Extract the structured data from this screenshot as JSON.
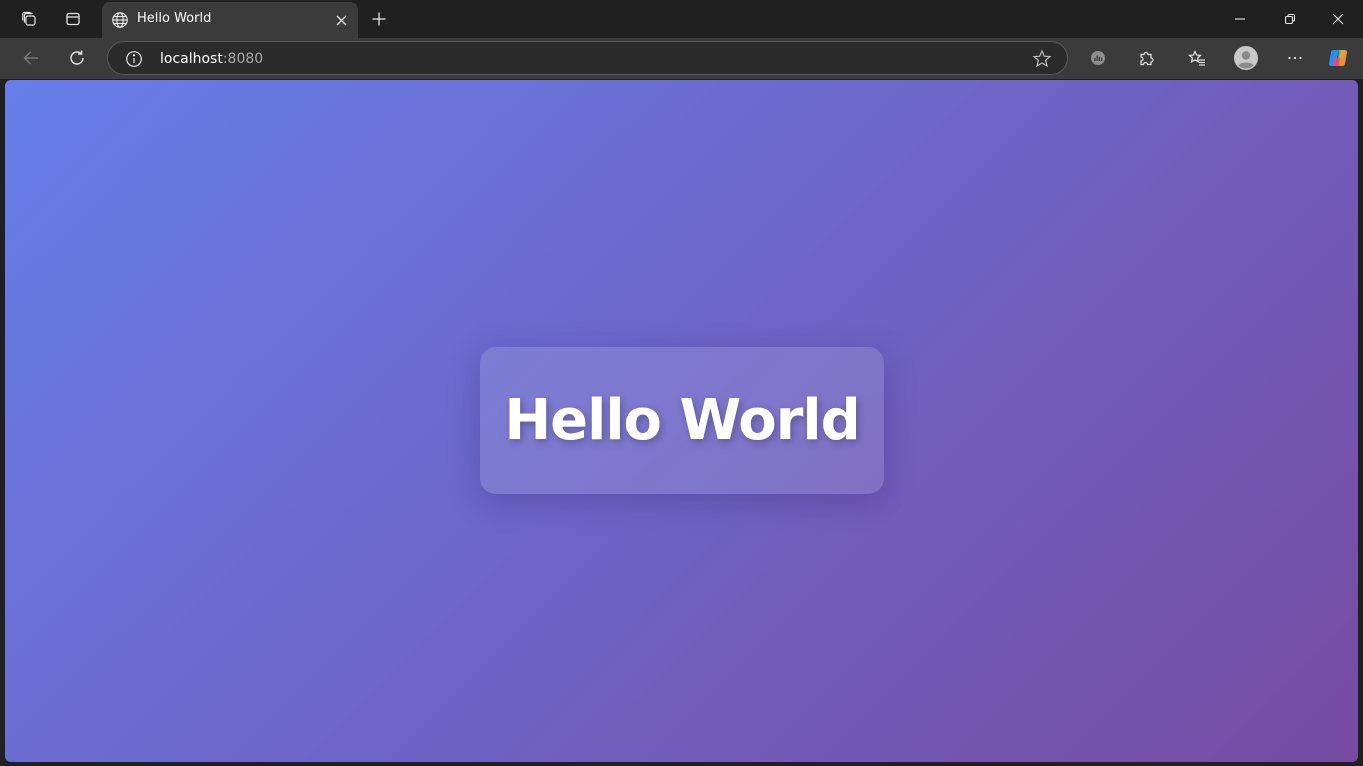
{
  "browser": {
    "tab": {
      "title": "Hello World",
      "favicon": "globe-icon"
    },
    "titlebar_icons": [
      "workspaces-icon",
      "tab-actions-icon",
      "new-tab-icon"
    ],
    "window_controls": [
      "minimize-icon",
      "restore-icon",
      "close-icon"
    ],
    "address_bar": {
      "host": "localhost",
      "port": ":8080",
      "site_info_icon": "info-icon",
      "favorite_icon": "star-icon"
    },
    "toolbar_icons": [
      "back-icon",
      "refresh-icon",
      "performance-icon",
      "extensions-icon",
      "favorites-icon",
      "profile-icon",
      "more-icon",
      "copilot-icon"
    ]
  },
  "page": {
    "heading": "Hello World"
  },
  "colors": {
    "gradient_start": "#667eea",
    "gradient_end": "#764ba2",
    "chrome_dark": "#202020",
    "chrome_toolbar": "#3b3b3b"
  }
}
